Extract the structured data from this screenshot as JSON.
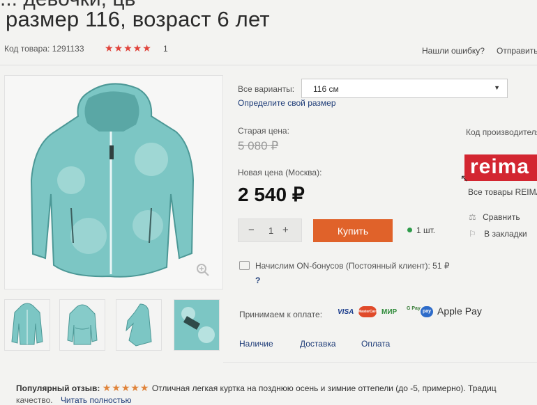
{
  "product": {
    "title_clip": "... девочки, цв",
    "title": "размер 116, возраст 6 лет",
    "code_label": "Код товара: 1291133",
    "stars": "★★★★★",
    "rating_count": "1",
    "report_link": "Нашли ошибку?",
    "send_link": "Отправить"
  },
  "variants": {
    "label": "Все варианты:",
    "selected": "116 см",
    "size_link": "Определите свой размер"
  },
  "price": {
    "old_label": "Старая цена:",
    "old_value": "5 080 ₽",
    "new_label": "Новая цена (Москва):",
    "new_value": "2 540 ₽"
  },
  "cart": {
    "minus": "−",
    "quantity": "1",
    "plus": "+",
    "buy_label": "Купить",
    "stock": "1 шт."
  },
  "brand": {
    "code_label": "Код производителя",
    "logo_text": "reima",
    "all_goods": "Все товары REIMA",
    "compare": "Сравнить",
    "bookmark": "В закладки"
  },
  "bonus": {
    "text": "Начислим ON-бонусов (Постоянный клиент): 51 ₽",
    "help": "?"
  },
  "payment": {
    "label": "Принимаем к оплате:",
    "methods": [
      "VISA",
      "MasterCard",
      "МИР",
      "G Pay",
      "pay",
      "Apple Pay"
    ]
  },
  "tabs": [
    "Наличие",
    "Доставка",
    "Оплата"
  ],
  "review": {
    "label": "Популярный отзыв:",
    "stars": "★★★★★",
    "text": "Отличная легкая куртка на позднюю осень и зимние оттепели (до -5, примерно). Традиц",
    "cont": "качество.",
    "read_more": "Читать полностью"
  },
  "colors": {
    "accent": "#e0622a",
    "brand": "#d32631",
    "link": "#1e3c78",
    "jacket": "#7cc6c4"
  }
}
